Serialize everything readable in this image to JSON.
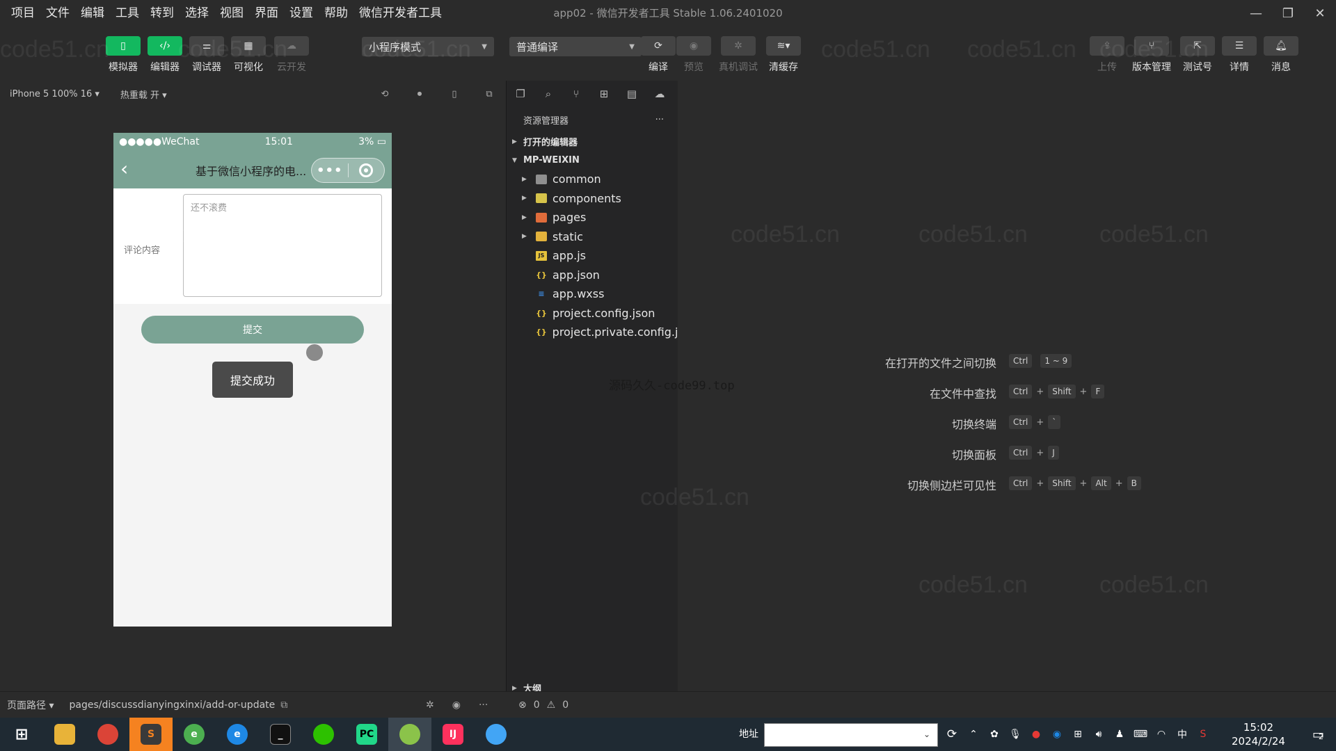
{
  "menu": [
    "项目",
    "文件",
    "编辑",
    "工具",
    "转到",
    "选择",
    "视图",
    "界面",
    "设置",
    "帮助",
    "微信开发者工具"
  ],
  "window_title": "app02 - 微信开发者工具 Stable 1.06.2401020",
  "toolbar": {
    "simulator": "模拟器",
    "editor": "编辑器",
    "debugger": "调试器",
    "visual": "可视化",
    "cloud": "云开发",
    "mode_select": "小程序模式",
    "compile_select": "普通编译",
    "compile": "编译",
    "preview": "预览",
    "real_debug": "真机调试",
    "clear_cache": "清缓存",
    "upload": "上传",
    "version": "版本管理",
    "test_account": "测试号",
    "details": "详情",
    "messages": "消息"
  },
  "devicebar": {
    "device": "iPhone 5 100% 16 ▾",
    "hot_reload": "热重载 开 ▾"
  },
  "phone": {
    "status_left": "●●●●●WeChat",
    "status_time": "15:01",
    "status_battery": "3%",
    "nav_title": "基于微信小程序的电...",
    "capsule_more": "•••",
    "form_label": "评论内容",
    "comment_placeholder": "还不滚费",
    "submit": "提交",
    "toast": "提交成功"
  },
  "explorer": {
    "title": "资源管理器",
    "more": "···",
    "open_editors": "打开的编辑器",
    "project": "MP-WEIXIN",
    "folders": [
      "common",
      "components",
      "pages",
      "static"
    ],
    "files": [
      {
        "name": "app.js",
        "type": "js"
      },
      {
        "name": "app.json",
        "type": "json"
      },
      {
        "name": "app.wxss",
        "type": "css"
      },
      {
        "name": "project.config.json",
        "type": "json"
      },
      {
        "name": "project.private.config.js...",
        "type": "json"
      }
    ],
    "outline": "大纲"
  },
  "editor": {
    "source_watermark": "源码久久-code99.top",
    "shortcuts": [
      {
        "label": "在打开的文件之间切换",
        "keys": [
          "Ctrl",
          "1 ~ 9"
        ]
      },
      {
        "label": "在文件中查找",
        "keys": [
          "Ctrl",
          "Shift",
          "F"
        ]
      },
      {
        "label": "切换终端",
        "keys": [
          "Ctrl",
          "`"
        ]
      },
      {
        "label": "切换面板",
        "keys": [
          "Ctrl",
          "J"
        ]
      },
      {
        "label": "切换侧边栏可见性",
        "keys": [
          "Ctrl",
          "Shift",
          "Alt",
          "B"
        ]
      }
    ]
  },
  "statusbar": {
    "path_label": "页面路径 ▾",
    "path_value": "pages/discussdianyingxinxi/add-or-update",
    "errors": "0",
    "warnings": "0"
  },
  "taskbar": {
    "address_label": "地址",
    "time": "15:02",
    "date": "2024/2/24",
    "ime": "中",
    "notify_count": "2"
  },
  "watermark_text": "code51.cn"
}
